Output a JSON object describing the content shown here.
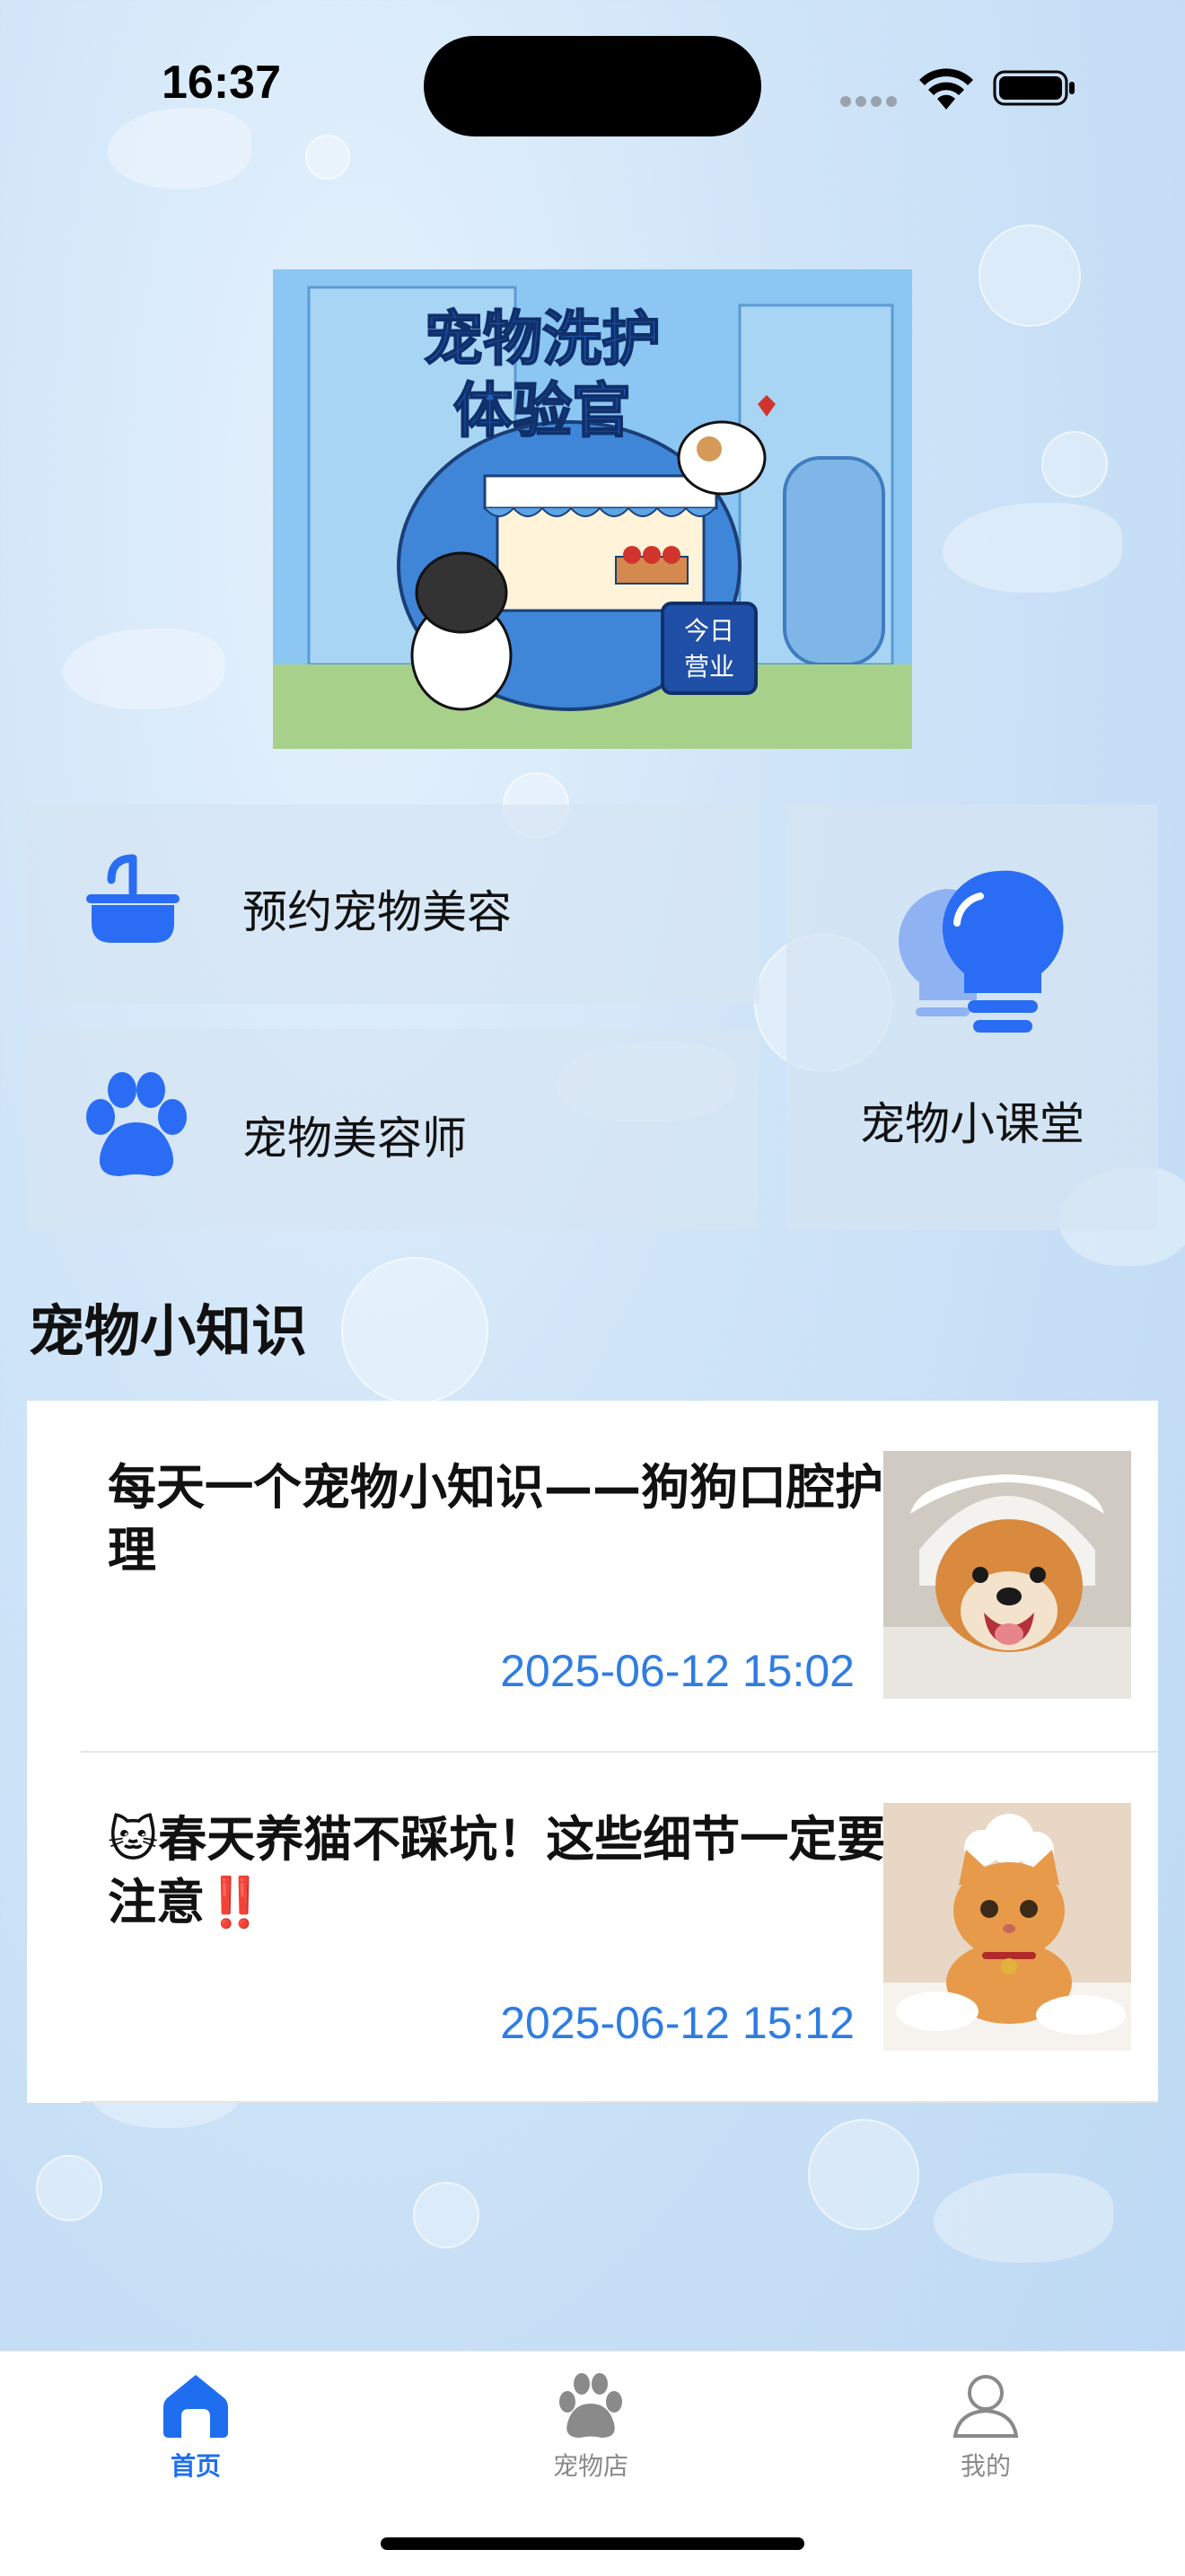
{
  "status_bar": {
    "time": "16:37"
  },
  "banner": {
    "title_line1": "宠物洗护",
    "title_line2": "体验官",
    "sign_line1": "今日",
    "sign_line2": "营业"
  },
  "menu": {
    "grooming_booking": "预约宠物美容",
    "groomers": "宠物美容师",
    "pet_class": "宠物小课堂"
  },
  "knowledge": {
    "section_title": "宠物小知识",
    "articles": [
      {
        "title": "每天一个宠物小知识——狗狗口腔护理",
        "time": "2025-06-12 15:02"
      },
      {
        "title": "🐱春天养猫不踩坑！这些细节一定要注意‼️",
        "time": "2025-06-12 15:12"
      }
    ]
  },
  "tabbar": {
    "tabs": [
      {
        "label": "首页",
        "icon": "home-icon",
        "active": true
      },
      {
        "label": "宠物店",
        "icon": "paw-icon",
        "active": false
      },
      {
        "label": "我的",
        "icon": "user-icon",
        "active": false
      }
    ]
  },
  "colors": {
    "accent": "#1f6ef0",
    "timestamp": "#2f7de1",
    "icon_blue": "#2a6df4"
  }
}
